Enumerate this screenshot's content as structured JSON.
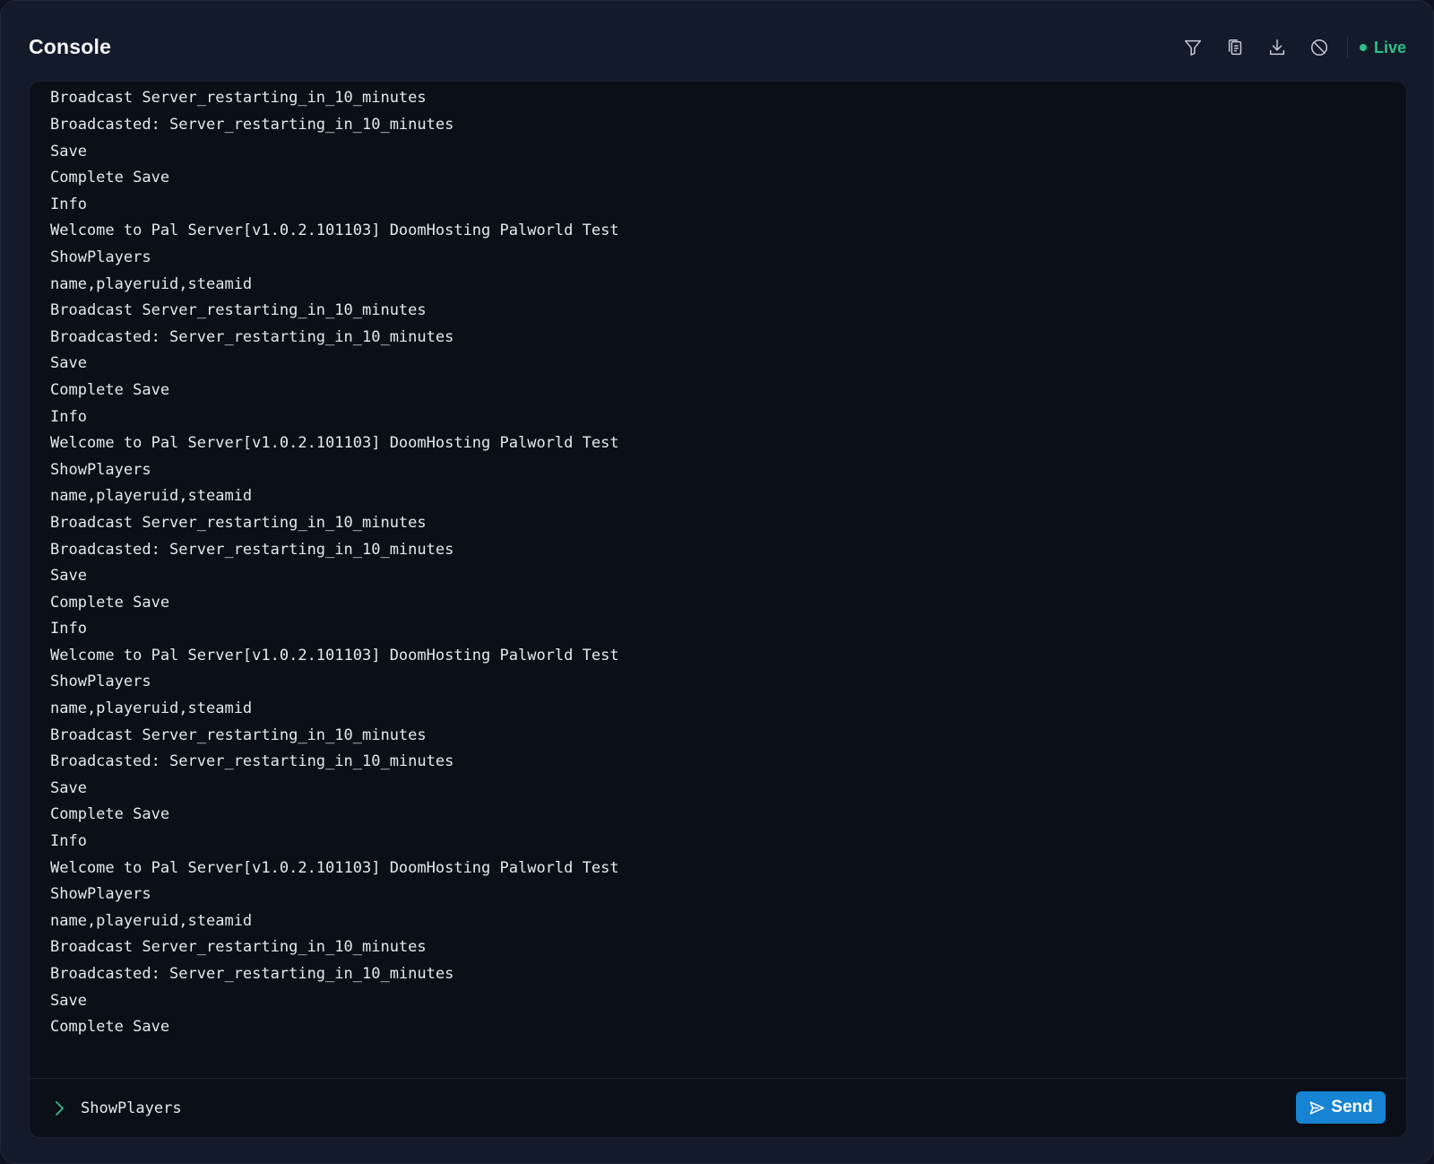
{
  "header": {
    "title": "Console",
    "toolbar": [
      {
        "name": "filter-icon"
      },
      {
        "name": "copy-icon"
      },
      {
        "name": "download-icon"
      },
      {
        "name": "clear-icon"
      }
    ],
    "status_label": "Live",
    "status_color": "#2ec08a"
  },
  "log": {
    "lines": [
      "name,playeruid,steamid",
      "Broadcast Server_restarting_in_10_minutes",
      "Broadcasted: Server_restarting_in_10_minutes",
      "Save",
      "Complete Save",
      "Info",
      "Welcome to Pal Server[v1.0.2.101103] DoomHosting Palworld Test",
      "ShowPlayers",
      "name,playeruid,steamid",
      "Broadcast Server_restarting_in_10_minutes",
      "Broadcasted: Server_restarting_in_10_minutes",
      "Save",
      "Complete Save",
      "Info",
      "Welcome to Pal Server[v1.0.2.101103] DoomHosting Palworld Test",
      "ShowPlayers",
      "name,playeruid,steamid",
      "Broadcast Server_restarting_in_10_minutes",
      "Broadcasted: Server_restarting_in_10_minutes",
      "Save",
      "Complete Save",
      "Info",
      "Welcome to Pal Server[v1.0.2.101103] DoomHosting Palworld Test",
      "ShowPlayers",
      "name,playeruid,steamid",
      "Broadcast Server_restarting_in_10_minutes",
      "Broadcasted: Server_restarting_in_10_minutes",
      "Save",
      "Complete Save",
      "Info",
      "Welcome to Pal Server[v1.0.2.101103] DoomHosting Palworld Test",
      "ShowPlayers",
      "name,playeruid,steamid",
      "Broadcast Server_restarting_in_10_minutes",
      "Broadcasted: Server_restarting_in_10_minutes",
      "Save",
      "Complete Save"
    ]
  },
  "input": {
    "value": "ShowPlayers",
    "send_label": "Send",
    "send_color": "#1683d3"
  }
}
